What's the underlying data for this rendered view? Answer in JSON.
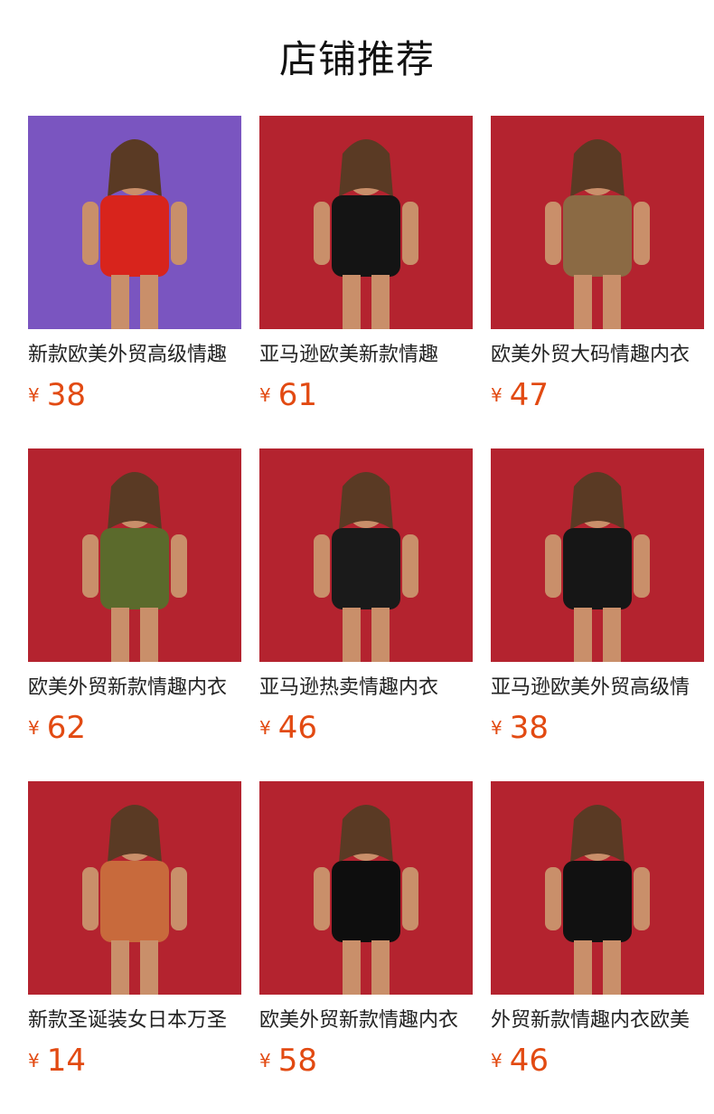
{
  "section_title": "店铺推荐",
  "currency": "¥",
  "products": [
    {
      "name": "新款欧美外贸高级情趣",
      "price": "38",
      "image": "red-mesh-top-outfit-photo",
      "bg": "#7a55c0",
      "garment": "#d8241c"
    },
    {
      "name": "亚马逊欧美新款情趣",
      "price": "61",
      "image": "police-costume-photo",
      "bg": "#b4232f",
      "garment": "#141414"
    },
    {
      "name": "欧美外贸大码情趣内衣",
      "price": "47",
      "image": "leopard-cat-costume-photo",
      "bg": "#b4232f",
      "garment": "#8b6a44"
    },
    {
      "name": "欧美外贸新款情趣内衣",
      "price": "62",
      "image": "military-costume-photo",
      "bg": "#b4232f",
      "garment": "#5b6a2c"
    },
    {
      "name": "亚马逊热卖情趣内衣",
      "price": "46",
      "image": "teacher-costume-photo",
      "bg": "#b4232f",
      "garment": "#1a1a1a"
    },
    {
      "name": "亚马逊欧美外贸高级情",
      "price": "38",
      "image": "bunny-costume-photo",
      "bg": "#b4232f",
      "garment": "#161616"
    },
    {
      "name": "新款圣诞装女日本万圣",
      "price": "14",
      "image": "reindeer-costume-photo",
      "bg": "#b4232f",
      "garment": "#c86a3c"
    },
    {
      "name": "欧美外贸新款情趣内衣",
      "price": "58",
      "image": "leather-police-costume-photo",
      "bg": "#b4232f",
      "garment": "#0e0e0e"
    },
    {
      "name": "外贸新款情趣内衣欧美",
      "price": "46",
      "image": "nun-costume-photo",
      "bg": "#b4232f",
      "garment": "#111111"
    }
  ]
}
